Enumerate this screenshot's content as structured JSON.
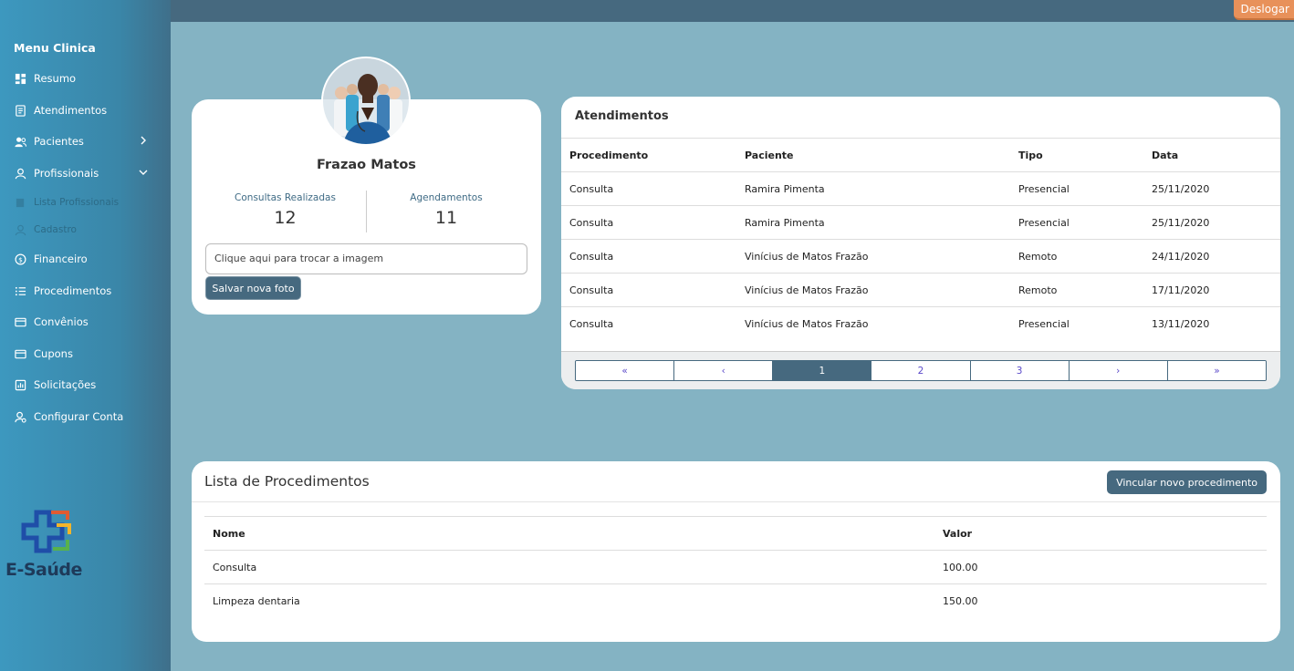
{
  "topbar": {
    "logout_label": "Deslogar"
  },
  "sidebar": {
    "menu_title": "Menu Clinica",
    "items": [
      {
        "label": "Resumo",
        "icon": "dashboard-icon"
      },
      {
        "label": "Atendimentos",
        "icon": "document-icon"
      },
      {
        "label": "Pacientes",
        "icon": "users-icon"
      },
      {
        "label": "Profissionais",
        "icon": "user-icon"
      },
      {
        "label": "Lista Profissionais",
        "icon": "list-icon"
      },
      {
        "label": "Cadastro",
        "icon": "user-icon"
      },
      {
        "label": "Financeiro",
        "icon": "dollar-icon"
      },
      {
        "label": "Procedimentos",
        "icon": "list-icon"
      },
      {
        "label": "Convênios",
        "icon": "card-icon"
      },
      {
        "label": "Cupons",
        "icon": "card-icon"
      },
      {
        "label": "Solicitações",
        "icon": "chart-icon"
      },
      {
        "label": "Configurar Conta",
        "icon": "user-settings-icon"
      }
    ],
    "logo_text": "E-Saúde"
  },
  "profile": {
    "name": "Frazao Matos",
    "consultas_label": "Consultas Realizadas",
    "consultas_value": "12",
    "agendamentos_label": "Agendamentos",
    "agendamentos_value": "11",
    "file_input_label": "Clique aqui para trocar a imagem",
    "save_button": "Salvar nova foto"
  },
  "atendimentos": {
    "title": "Atendimentos",
    "columns": [
      "Procedimento",
      "Paciente",
      "Tipo",
      "Data"
    ],
    "rows": [
      [
        "Consulta",
        "Ramira Pimenta",
        "Presencial",
        "25/11/2020"
      ],
      [
        "Consulta",
        "Ramira Pimenta",
        "Presencial",
        "25/11/2020"
      ],
      [
        "Consulta",
        "Vinícius de Matos Frazão",
        "Remoto",
        "24/11/2020"
      ],
      [
        "Consulta",
        "Vinícius de Matos Frazão",
        "Remoto",
        "17/11/2020"
      ],
      [
        "Consulta",
        "Vinícius de Matos Frazão",
        "Presencial",
        "13/11/2020"
      ]
    ],
    "pagination": [
      "«",
      "‹",
      "1",
      "2",
      "3",
      "›",
      "»"
    ],
    "active_page": "1"
  },
  "procedimentos": {
    "title": "Lista de Procedimentos",
    "link_button": "Vincular novo procedimento",
    "columns": [
      "Nome",
      "Valor"
    ],
    "rows": [
      [
        "Consulta",
        "100.00"
      ],
      [
        "Limpeza dentaria",
        "150.00"
      ]
    ]
  }
}
